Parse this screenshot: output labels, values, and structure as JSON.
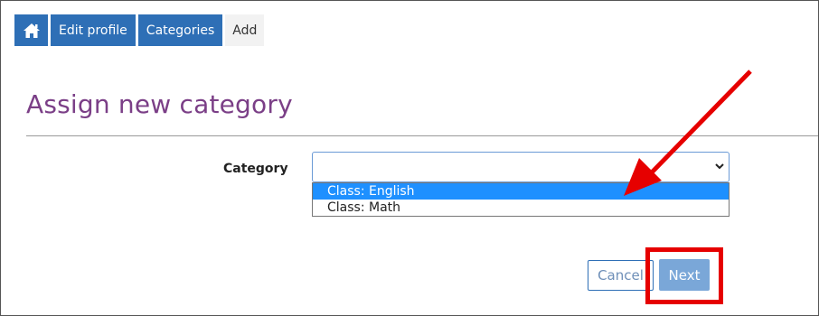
{
  "breadcrumb": {
    "home_icon": "home-icon",
    "items": [
      {
        "label": "Edit profile"
      },
      {
        "label": "Categories"
      },
      {
        "label": "Add"
      }
    ]
  },
  "page": {
    "title": "Assign new category"
  },
  "form": {
    "category_label": "Category",
    "category_selected": "",
    "options": [
      {
        "label": "Class: English",
        "highlighted": true
      },
      {
        "label": "Class: Math",
        "highlighted": false
      }
    ],
    "cancel_label": "Cancel",
    "next_label": "Next"
  },
  "colors": {
    "brand_blue": "#2e6fb6",
    "title_purple": "#7b3f87",
    "option_highlight": "#1e90ff",
    "next_button": "#7aa7d8",
    "annotation_red": "#e60000"
  }
}
